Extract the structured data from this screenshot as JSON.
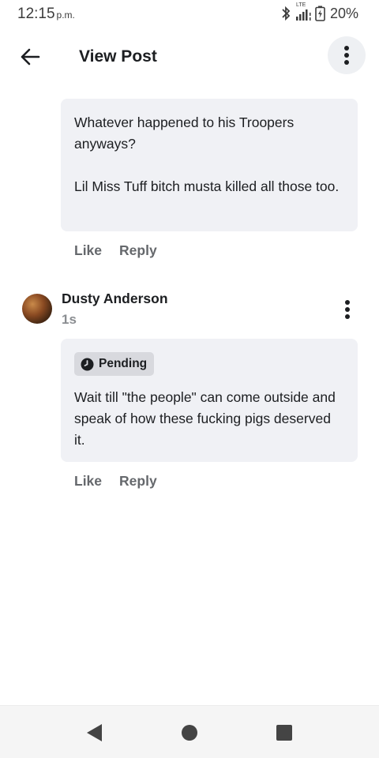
{
  "status_bar": {
    "time": "12:15",
    "ampm": "p.m.",
    "network": "LTE",
    "battery": "20%"
  },
  "app_bar": {
    "title": "View Post",
    "back_icon": "arrow-left-icon",
    "menu_icon": "more-vertical-icon"
  },
  "comments": [
    {
      "paragraphs": [
        "Whatever happened to his Troopers anyways?",
        "Lil Miss Tuff bitch musta killed all those too."
      ],
      "like_label": "Like",
      "reply_label": "Reply"
    },
    {
      "author": "Dusty Anderson",
      "time": "1s",
      "pending_label": "Pending",
      "text": "Wait till \"the people\" can come outside and speak of how these fucking pigs deserved it.",
      "like_label": "Like",
      "reply_label": "Reply"
    }
  ],
  "nav_bar": {
    "back_icon": "triangle-back-icon",
    "home_icon": "circle-home-icon",
    "recents_icon": "square-recents-icon"
  },
  "colors": {
    "bubble": "#f0f1f5",
    "secondary_text": "#65686c",
    "badge": "#d8d9de"
  }
}
